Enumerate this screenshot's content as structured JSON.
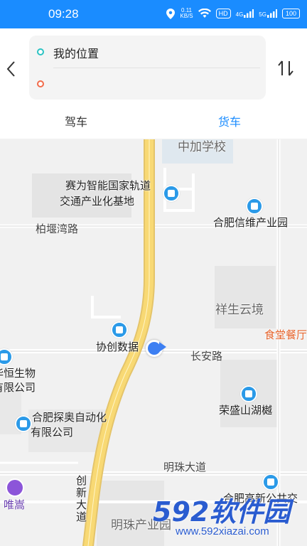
{
  "status_bar": {
    "time": "09:28",
    "net_speed_value": "0.11",
    "net_speed_unit": "KB/S",
    "hd_label": "HD",
    "signal_1": "4G",
    "signal_2": "5G",
    "battery": "100",
    "icons": [
      "location-icon",
      "wifi-icon",
      "signal-icon",
      "battery-icon"
    ]
  },
  "route": {
    "start_text": "我的位置",
    "end_text": "",
    "start_color": "#2bc3c3",
    "end_color": "#f26b4a"
  },
  "tabs": [
    {
      "label": "驾车",
      "active": false
    },
    {
      "label": "货车",
      "active": true
    }
  ],
  "accent_color": "#1a8cff",
  "map": {
    "labels": {
      "school": "中加学校",
      "saiwei_1": "赛为智能国家轨道",
      "saiwei_2": "交通产业化基地",
      "baiyan_road": "柏堰湾路",
      "xinwei": "合肥信维产业园",
      "xiangsheng": "祥生云境",
      "canteen": "食堂餐厅",
      "xiechuang": "协创数据",
      "changan_road": "长安路",
      "bio_1": "华恒生物",
      "bio_2": "有限公司",
      "rongsheng": "荣盛山湖樾",
      "tanao_1": "合肥探奥自动化",
      "tanao_2": "有限公司",
      "mingzhu_road": "明珠大道",
      "chuangxin_road": "创新大道",
      "weisong": "唯嵩",
      "mingzhu_park": "明珠产业园",
      "hefei_gaoxin": "合肥高新公共交"
    }
  },
  "watermark": {
    "brand": "592软件园",
    "url": "www.592xiazai.com"
  }
}
